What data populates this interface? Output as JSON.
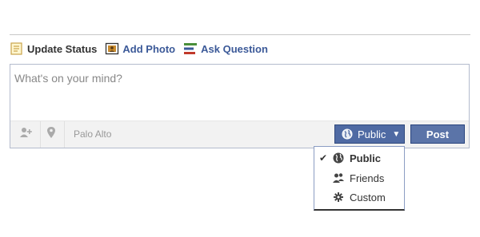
{
  "tabs": [
    {
      "label": "Update Status",
      "icon": "status-icon",
      "active": true
    },
    {
      "label": "Add Photo",
      "icon": "photo-icon",
      "active": false
    },
    {
      "label": "Ask Question",
      "icon": "question-icon",
      "active": false
    }
  ],
  "composer": {
    "placeholder": "What's on your mind?",
    "location": "Palo Alto"
  },
  "toolbar": {
    "tag_icon": "tag-friends-icon",
    "location_icon": "location-pin-icon"
  },
  "privacy": {
    "selected": "Public",
    "icon": "globe-icon"
  },
  "post_label": "Post",
  "audience_menu": {
    "items": [
      {
        "label": "Public",
        "icon": "globe-icon",
        "checked": true
      },
      {
        "label": "Friends",
        "icon": "friends-icon",
        "checked": false
      },
      {
        "label": "Custom",
        "icon": "gear-icon",
        "checked": false
      }
    ],
    "check_glyph": "✔"
  },
  "colors": {
    "link": "#3b5998",
    "button": "#5b74a8",
    "border": "#b4bbcd"
  }
}
